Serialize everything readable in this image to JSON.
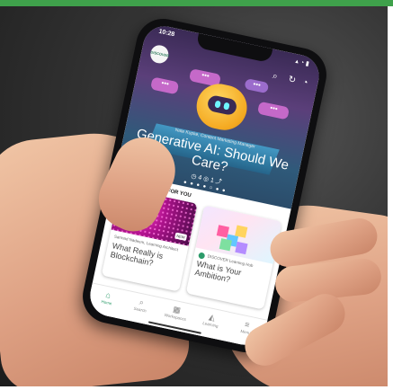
{
  "status": {
    "time": "10:28",
    "icons": "▴ ◔ ▮"
  },
  "app": {
    "logo_text": "DISCOVER"
  },
  "hero": {
    "author": "Nate Kupke, Content Marketing Manager",
    "title": "Generative AI: Should We Care?",
    "meta": "◷ 4  ◎ 1  ⤴",
    "dots": "● ● ● ● ○ ● ●"
  },
  "section_title": "RECOMMENDED FOR YOU",
  "cards": [
    {
      "author": "Sarmad Nadeem, Learning Architect",
      "title": "What Really is Blockchain?",
      "tag": "NEW"
    },
    {
      "author": "DISCOVER Learning Hub",
      "title": "What is Your Ambition?"
    }
  ],
  "nav": [
    {
      "label": "Home",
      "icon": "home-icon",
      "glyph": "⌂"
    },
    {
      "label": "Search",
      "icon": "search-icon",
      "glyph": "⌕"
    },
    {
      "label": "Workspaces",
      "icon": "grid-icon",
      "glyph": "▦"
    },
    {
      "label": "Learning",
      "icon": "cap-icon",
      "glyph": "◭"
    },
    {
      "label": "Menu",
      "icon": "menu-icon",
      "glyph": "≡"
    }
  ],
  "colors": {
    "banner": "#3fa14b",
    "accent": "#2c9b6a",
    "robot": "#f4a921"
  }
}
